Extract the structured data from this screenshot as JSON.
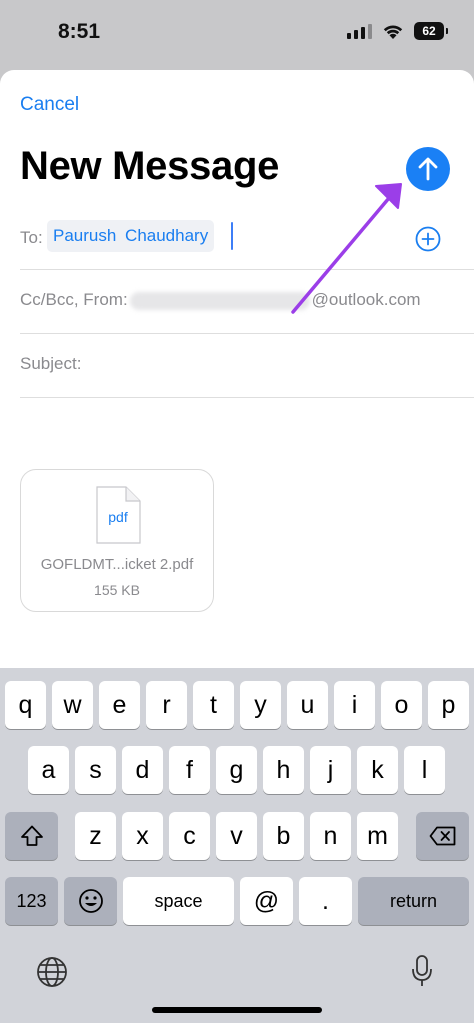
{
  "status_bar": {
    "time": "8:51",
    "battery_level": "62"
  },
  "header": {
    "cancel_label": "Cancel",
    "title": "New Message"
  },
  "fields": {
    "to_label": "To:",
    "to_recipient": "Paurush Chaudhary",
    "ccbcc_prefix": "Cc/Bcc, From:",
    "ccbcc_suffix": "@outlook.com",
    "subject_label": "Subject:"
  },
  "attachment": {
    "icon_text": "pdf",
    "name": "GOFLDMT...icket 2.pdf",
    "size": "155 KB"
  },
  "keyboard": {
    "row1": [
      "q",
      "w",
      "e",
      "r",
      "t",
      "y",
      "u",
      "i",
      "o",
      "p"
    ],
    "row2": [
      "a",
      "s",
      "d",
      "f",
      "g",
      "h",
      "j",
      "k",
      "l"
    ],
    "row3": [
      "z",
      "x",
      "c",
      "v",
      "b",
      "n",
      "m"
    ],
    "numbers_label": "123",
    "space_label": "space",
    "at_label": "@",
    "dot_label": ".",
    "return_label": "return"
  },
  "colors": {
    "accent": "#1a80f5",
    "annotation": "#9b3ee8",
    "keyboard_bg": "#d1d3d9"
  }
}
